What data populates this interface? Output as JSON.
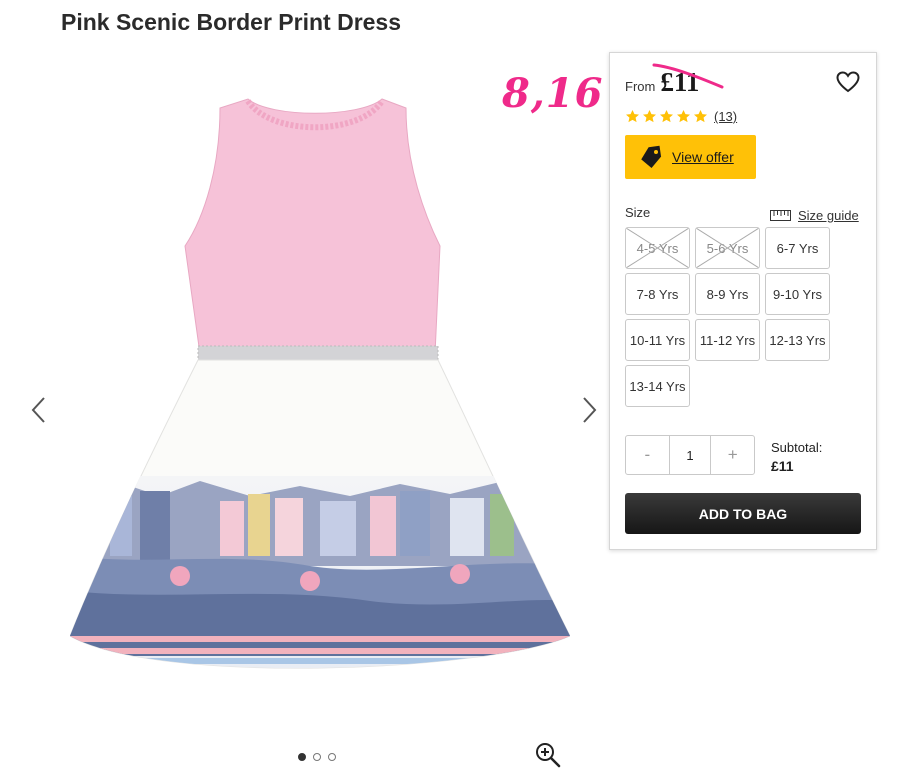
{
  "product": {
    "title": "Pink Scenic Border Print Dress",
    "from_label": "From",
    "price": "£11",
    "review_count": "(13)",
    "rating_stars": 5,
    "handwritten_annotation": "8,16"
  },
  "offer": {
    "label": "View offer"
  },
  "size_section": {
    "label": "Size",
    "guide_label": "Size guide",
    "options": [
      {
        "label": "4-5 Yrs",
        "available": false
      },
      {
        "label": "5-6 Yrs",
        "available": false
      },
      {
        "label": "6-7 Yrs",
        "available": true
      },
      {
        "label": "7-8 Yrs",
        "available": true
      },
      {
        "label": "8-9 Yrs",
        "available": true
      },
      {
        "label": "9-10 Yrs",
        "available": true
      },
      {
        "label": "10-11 Yrs",
        "available": true
      },
      {
        "label": "11-12 Yrs",
        "available": true
      },
      {
        "label": "12-13 Yrs",
        "available": true
      },
      {
        "label": "13-14 Yrs",
        "available": true
      }
    ]
  },
  "quantity": {
    "minus": "-",
    "value": "1",
    "plus": "+"
  },
  "subtotal": {
    "label": "Subtotal:",
    "amount": "£11"
  },
  "add_to_bag": "ADD TO BAG",
  "gallery": {
    "image_count": 3,
    "active_index": 0
  },
  "colors": {
    "offer_bg": "#ffc107",
    "star": "#ffc107",
    "annotation": "#ef2a8a",
    "button_dark": "#1f1f1f"
  }
}
